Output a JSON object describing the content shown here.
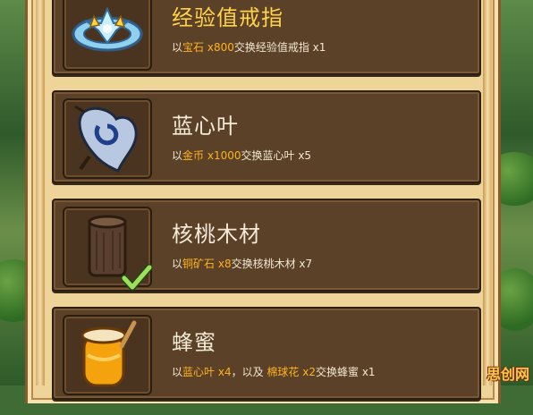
{
  "items": [
    {
      "title": "经验值戒指",
      "desc": {
        "pre": "以",
        "cost_item": "宝石",
        "cost_qty": " x800",
        "post": "交换经验值戒指 x1"
      },
      "icon": "ring-icon",
      "title_color": "#ffd24a"
    },
    {
      "title": "蓝心叶",
      "desc": {
        "pre": "以",
        "cost_item": "金币",
        "cost_qty": " x1000",
        "post": "交换蓝心叶 x5"
      },
      "icon": "heart-leaf-icon"
    },
    {
      "title": "核桃木材",
      "desc": {
        "pre": "以",
        "cost_item": "铜矿石",
        "cost_qty": " x8",
        "post": "交换核桃木材 x7"
      },
      "icon": "wood-log-icon",
      "completed": true
    },
    {
      "title": "蜂蜜",
      "desc": {
        "pre": "以",
        "cost_item": "蓝心叶",
        "cost_qty": " x4",
        "mid": "，以及 ",
        "cost_item2": "棉球花",
        "cost_qty2": " x2",
        "post": "交换蜂蜜 x1"
      },
      "icon": "honey-jar-icon"
    }
  ],
  "watermark": "思创网",
  "colors": {
    "highlight": "#ffb21e",
    "title_gold": "#ffd24a",
    "panel": "#5b4128",
    "parchment": "#efd49a"
  }
}
